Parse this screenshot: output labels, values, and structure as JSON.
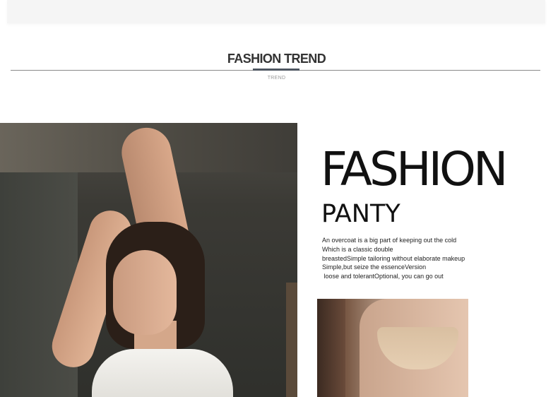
{
  "header": {
    "title": "FASHION TREND",
    "subtitle": "TREND"
  },
  "feature": {
    "headline": "FASHION",
    "subheadline": "PANTY",
    "description": [
      "An overcoat is a big part of keeping out the cold",
      "Which is a classic double",
      "breastedSimple tailoring without elaborate makeup",
      "Simple,but seize the essenceVersion",
      " loose and tolerantOptional, you can go out"
    ]
  }
}
